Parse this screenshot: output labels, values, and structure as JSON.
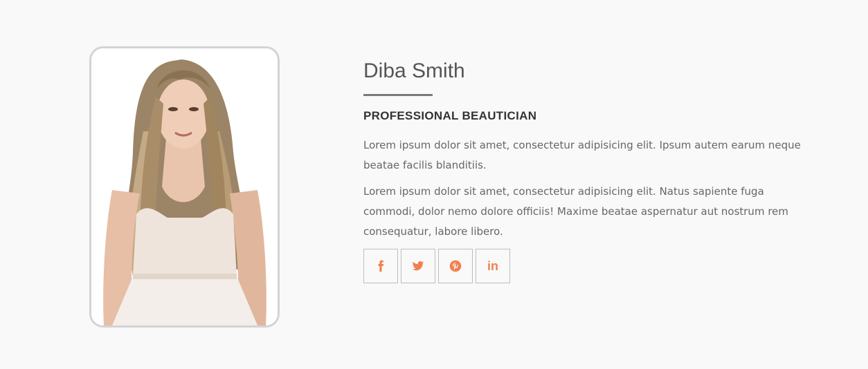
{
  "profile": {
    "name": "Diba Smith",
    "role": "PROFESSIONAL BEAUTICIAN",
    "paragraphs": [
      "Lorem ipsum dolor sit amet, consectetur adipisicing elit. Ipsum autem earum neque beatae facilis blanditiis.",
      "Lorem ipsum dolor sit amet, consectetur adipisicing elit. Natus sapiente fuga commodi, dolor nemo dolore officiis! Maxime beatae aspernatur aut nostrum rem consequatur, labore libero."
    ],
    "photo_icon": "portrait-photo"
  },
  "social": {
    "icon_color": "#f0804f",
    "items": [
      {
        "icon": "facebook-icon"
      },
      {
        "icon": "twitter-icon"
      },
      {
        "icon": "pinterest-icon"
      },
      {
        "icon": "linkedin-icon",
        "glyph": "in"
      }
    ]
  },
  "colors": {
    "background": "#f9f9f9",
    "frame_border": "#d3d3d3",
    "accent": "#f0804f"
  }
}
